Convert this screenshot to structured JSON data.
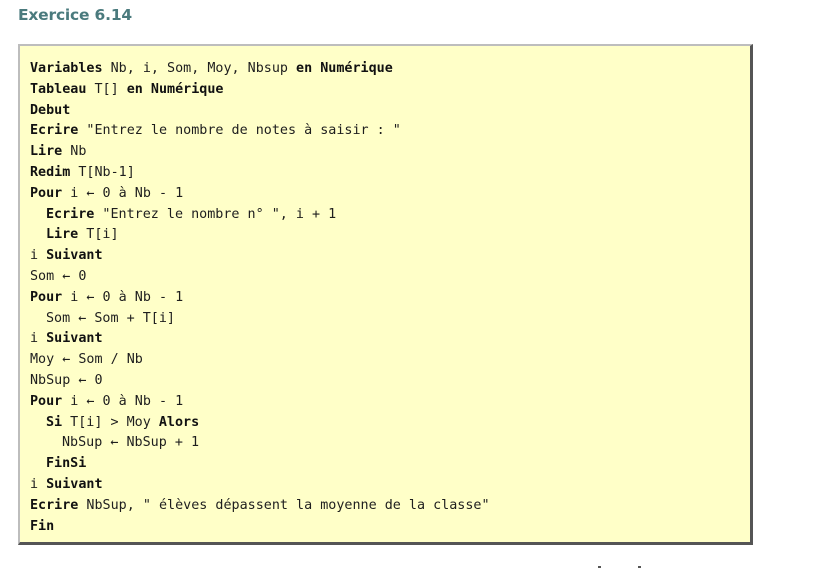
{
  "title": "Exercice 6.14",
  "code": {
    "l1": {
      "k1": "Variables",
      "t1": " Nb, i, Som, Moy, Nbsup ",
      "k2": "en Numérique"
    },
    "l2": {
      "k1": "Tableau",
      "t1": " T[] ",
      "k2": "en Numérique"
    },
    "l3": {
      "k1": "Debut"
    },
    "l4": {
      "k1": "Ecrire",
      "t1": " \"Entrez le nombre de notes à saisir : \""
    },
    "l5": {
      "k1": "Lire",
      "t1": " Nb"
    },
    "l6": {
      "k1": "Redim",
      "t1": " T[Nb-1]"
    },
    "l7": {
      "k1": "Pour",
      "t1": " i ← 0 à Nb - 1"
    },
    "l8": {
      "k1": "Ecrire",
      "t1": " \"Entrez le nombre n° \", i + 1"
    },
    "l9": {
      "k1": "Lire",
      "t1": " T[i]"
    },
    "l10": {
      "t1": "i ",
      "k1": "Suivant"
    },
    "l11": {
      "t1": "Som ← 0"
    },
    "l12": {
      "k1": "Pour",
      "t1": " i ← 0 à Nb - 1"
    },
    "l13": {
      "t1": "Som ← Som + T[i]"
    },
    "l14": {
      "t1": "i ",
      "k1": "Suivant"
    },
    "l15": {
      "t1": "Moy ← Som / Nb"
    },
    "l16": {
      "t1": "NbSup ← 0"
    },
    "l17": {
      "k1": "Pour",
      "t1": " i ← 0 à Nb - 1"
    },
    "l18": {
      "k1": "Si",
      "t1": " T[i] > Moy ",
      "k2": "Alors"
    },
    "l19": {
      "t1": "NbSup ← NbSup + 1"
    },
    "l20": {
      "k1": "FinSi"
    },
    "l21": {
      "t1": "i ",
      "k1": "Suivant"
    },
    "l22": {
      "k1": "Ecrire",
      "t1": " NbSup, \" élèves dépassent la moyenne de la classe\""
    },
    "l23": {
      "k1": "Fin"
    }
  }
}
